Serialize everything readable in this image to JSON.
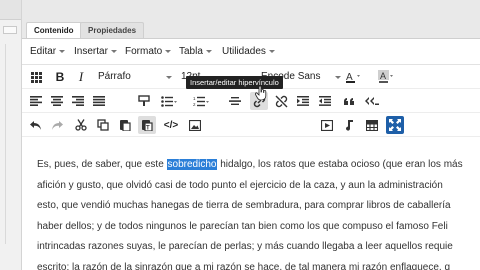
{
  "tabs": [
    {
      "label": "Contenido",
      "active": true
    },
    {
      "label": "Propiedades",
      "active": false
    }
  ],
  "menubar": [
    "Editar",
    "Insertar",
    "Formato",
    "Tabla",
    "Utilidades"
  ],
  "toolbar": {
    "paragraph_format": "Párrafo",
    "font_size": "12pt",
    "font_family": "Encode Sans",
    "tooltip": "Insertar/editar hipervínculo"
  },
  "icons": {
    "row1": [
      "source-grid-icon",
      "bold-icon",
      "italic-icon",
      "paragraph-dropdown",
      "size-dropdown",
      "font-dropdown",
      "text-color-icon",
      "highlight-color-icon"
    ],
    "row2": [
      "align-left-icon",
      "align-center-icon",
      "align-right-icon",
      "align-justify-icon",
      "format-painter-icon",
      "bullet-list-icon",
      "numbered-list-icon",
      "horizontal-rule-icon",
      "link-icon",
      "unlink-icon",
      "indent-icon",
      "outdent-icon",
      "blockquote-icon",
      "quote-icon"
    ],
    "row3": [
      "undo-icon",
      "redo-icon",
      "cut-icon",
      "copy-icon",
      "paste-icon",
      "paste-text-icon",
      "code-icon",
      "image-icon",
      "media-icon",
      "music-icon",
      "table-icon",
      "fullscreen-icon"
    ]
  },
  "colors": {
    "accent": "#1e5fa8",
    "selection": "#2b7fd8"
  },
  "content": {
    "l1_before": "Es, pues, de saber, que este ",
    "l1_selected": "sobredicho",
    "l1_after": " hidalgo, los ratos que estaba ocioso (que eran los más",
    "l2": "afición y gusto, que olvidó casi de todo punto el ejercicio de la caza, y aun la administración",
    "l3": "esto, que vendió muchas hanegas de tierra de sembradura, para comprar libros de caballería",
    "l4": "haber dellos; y de todos ningunos le parecían tan bien como los que compuso el famoso Feli",
    "l5": "intrincadas razones suyas, le parecían de perlas; y más cuando llegaba a leer aquellos requie",
    "l6": "escrito: la razón de la sinrazón que a mi razón se hace, de tal manera mi razón enflaquece, q"
  }
}
